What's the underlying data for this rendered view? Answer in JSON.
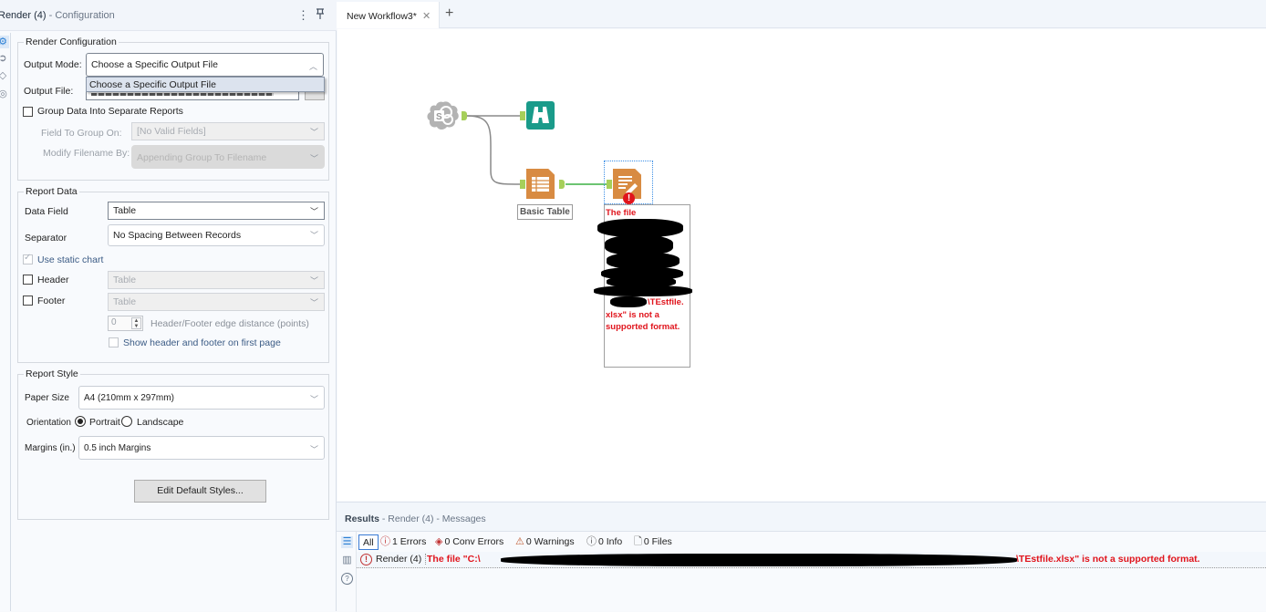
{
  "config_panel": {
    "title": "Render (4)",
    "subtitle": "- Configuration",
    "menu_icon": "more-vertical-icon",
    "pin_icon": "pin-icon",
    "side_icons": [
      "gear-icon",
      "arrow-in-icon",
      "tag-icon",
      "annotation-icon"
    ],
    "render_configuration": {
      "legend": "Render Configuration",
      "output_mode_label": "Output Mode:",
      "output_mode_value": "Choose a Specific Output File",
      "output_mode_dropdown_open": true,
      "output_mode_options": [
        "Choose a Specific Output File"
      ],
      "output_file_label": "Output File:",
      "output_file_value": "[redacted path]",
      "group_checkbox_label": "Group Data Into Separate Reports",
      "group_checked": false,
      "field_to_group_label": "Field To Group On:",
      "field_to_group_value": "[No Valid Fields]",
      "modify_filename_label": "Modify Filename By:",
      "modify_filename_value": "Appending Group To Filename"
    },
    "report_data": {
      "legend": "Report Data",
      "data_field_label": "Data Field",
      "data_field_value": "Table",
      "separator_label": "Separator",
      "separator_value": "No Spacing Between Records",
      "static_chart_label": "Use static chart",
      "static_chart_checked": true,
      "header_label": "Header",
      "header_checked": false,
      "header_value": "Table",
      "footer_label": "Footer",
      "footer_checked": false,
      "footer_value": "Table",
      "edge_distance_value": "0",
      "edge_distance_label": "Header/Footer edge distance (points)",
      "show_first_page_label": "Show header and footer on first page",
      "show_first_page_checked": false
    },
    "report_style": {
      "legend": "Report Style",
      "paper_size_label": "Paper Size",
      "paper_size_value": "A4 (210mm x 297mm)",
      "orientation_label": "Orientation",
      "orientation_options": [
        "Portrait",
        "Landscape"
      ],
      "orientation_selected": "Portrait",
      "margins_label": "Margins (in.)",
      "margins_value": "0.5 inch Margins",
      "edit_styles_button": "Edit Default Styles..."
    }
  },
  "tabs": {
    "items": [
      {
        "label": "New Workflow3*",
        "active": true
      }
    ],
    "add_icon": "plus-icon",
    "close_icon": "close-icon"
  },
  "workflow": {
    "tools": [
      {
        "name": "sharepoint-input",
        "icon": "sharepoint-icon",
        "color": "#b3b3b3"
      },
      {
        "name": "browse",
        "icon": "binoculars-icon",
        "color": "#1a9b8a"
      },
      {
        "name": "basic-table",
        "icon": "table-icon",
        "color": "#d88b42",
        "label": "Basic Table"
      },
      {
        "name": "render",
        "icon": "render-icon",
        "color": "#d88b42",
        "error": true
      }
    ],
    "error_annotation": {
      "line1": "The file",
      "line2": "\\TEstfile.",
      "line3": "xlsx\" is not a",
      "line4": "supported format."
    },
    "connection_color": "#3cb043",
    "anchor_color": "#a6cf5a"
  },
  "results": {
    "title": "Results",
    "subtitle": "- Render (4) - Messages",
    "filters": [
      {
        "label": "All",
        "icon": ""
      },
      {
        "label": "1 Errors",
        "icon": "error-icon"
      },
      {
        "label": "0 Conv Errors",
        "icon": "conv-error-icon"
      },
      {
        "label": "0 Warnings",
        "icon": "warning-icon"
      },
      {
        "label": "0 Info",
        "icon": "info-icon"
      },
      {
        "label": "0 Files",
        "icon": "file-icon"
      }
    ],
    "messages": [
      {
        "tool": "Render (4)",
        "text_start": "The file \"C:\\",
        "text_end": "\\TEstfile.xlsx\" is not a supported format.",
        "level": "error"
      }
    ],
    "error_color": "#e0141c"
  }
}
